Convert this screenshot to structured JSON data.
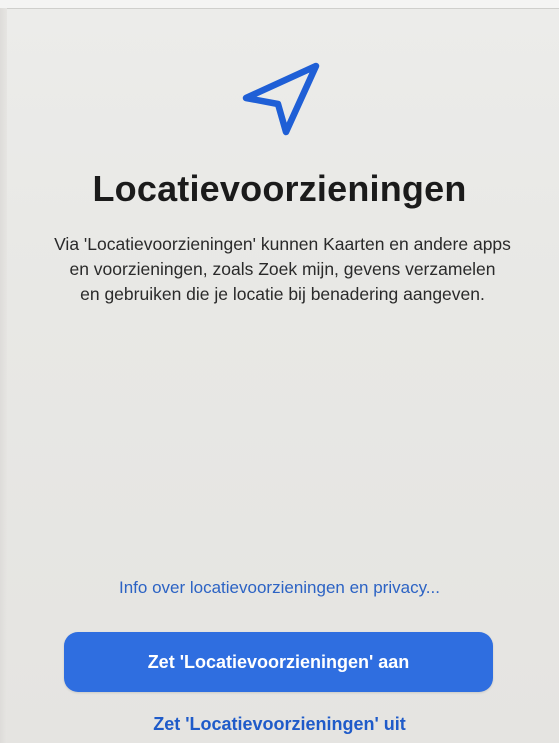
{
  "page": {
    "title": "Locatievoorzieningen",
    "description_lines": [
      "Via 'Locatievoorzieningen' kunnen Kaarten en andere apps",
      "en voorzieningen, zoals Zoek mijn, gevens verzamelen",
      "en gebruiken die je locatie bij benadering aangeven."
    ],
    "icon": "location-arrow-icon"
  },
  "links": {
    "info": "Info over locatievoorzieningen en privacy..."
  },
  "buttons": {
    "enable": "Zet 'Locatievoorzieningen' aan",
    "disable": "Zet 'Locatievoorzieningen' uit"
  },
  "colors": {
    "accent": "#2f6ee0",
    "link": "#2c63c4",
    "icon": "#1f5fd6"
  }
}
